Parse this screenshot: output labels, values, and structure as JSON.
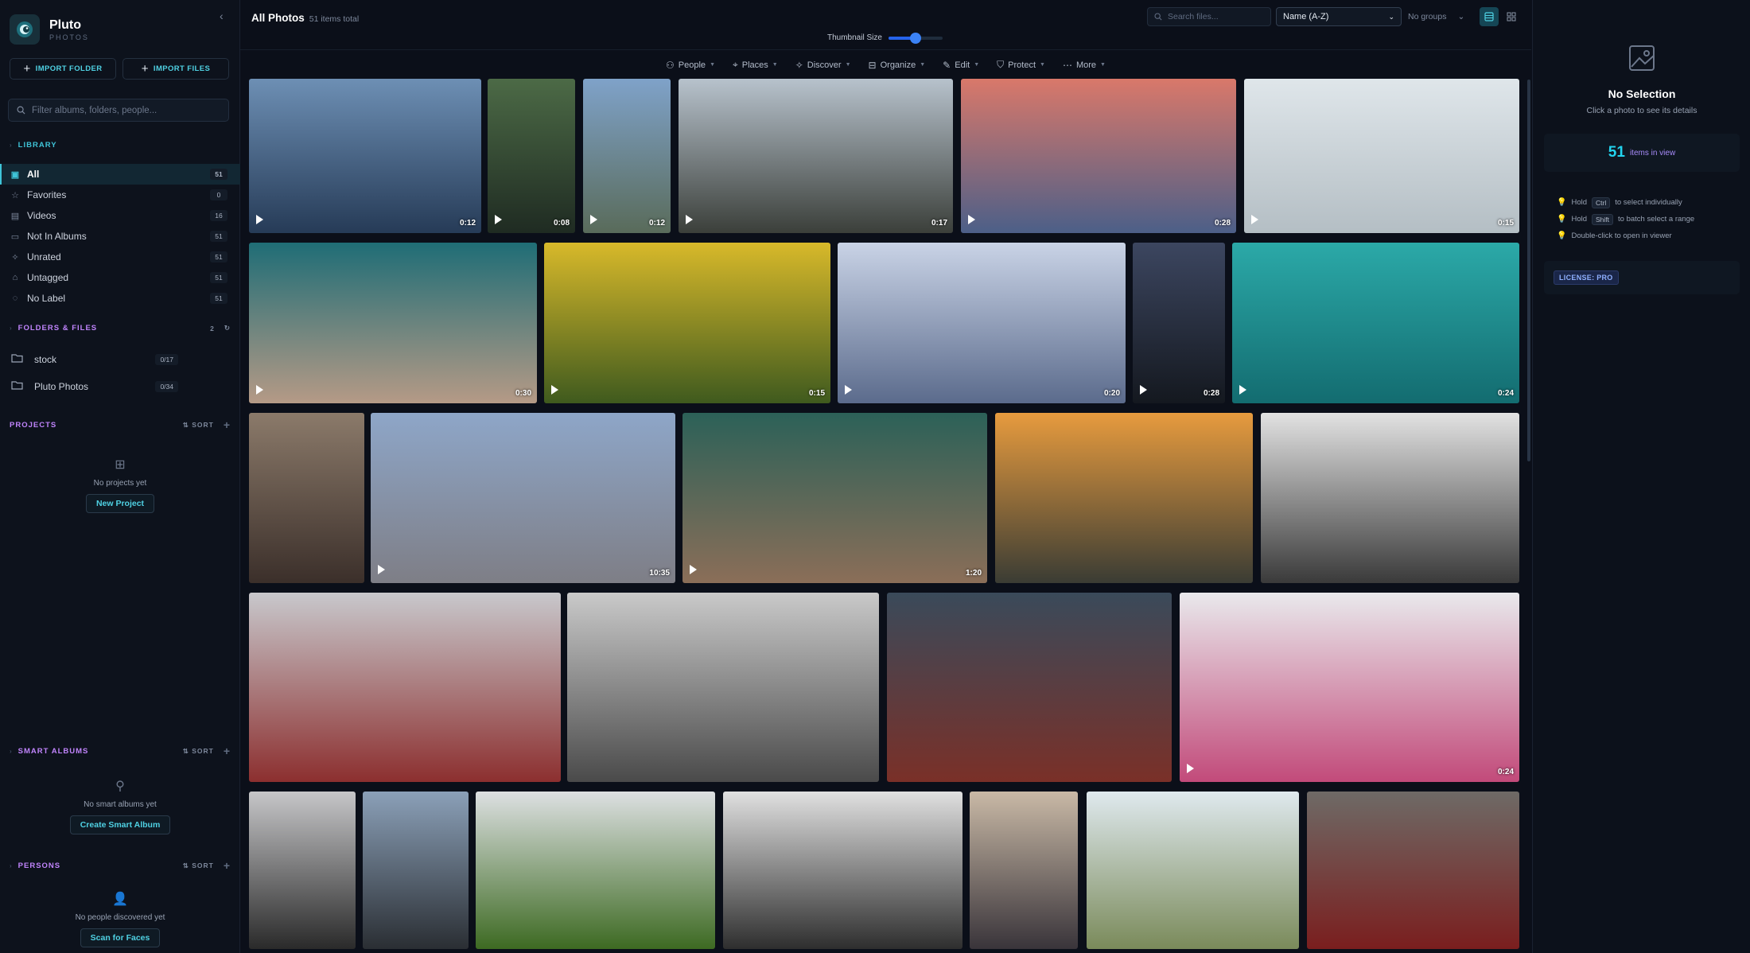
{
  "app": {
    "name": "Pluto",
    "subtitle": "PHOTOS"
  },
  "sidebar": {
    "import_folder": "IMPORT FOLDER",
    "import_files": "IMPORT FILES",
    "filter_placeholder": "Filter albums, folders, people...",
    "library_title": "LIBRARY",
    "library": [
      {
        "label": "All",
        "count": "51",
        "icon": "all-photos-icon"
      },
      {
        "label": "Favorites",
        "count": "0",
        "icon": "star-icon"
      },
      {
        "label": "Videos",
        "count": "16",
        "icon": "film-icon"
      },
      {
        "label": "Not In Albums",
        "count": "51",
        "icon": "folder-off-icon"
      },
      {
        "label": "Unrated",
        "count": "51",
        "icon": "star-outline-icon"
      },
      {
        "label": "Untagged",
        "count": "51",
        "icon": "tag-icon"
      },
      {
        "label": "No Label",
        "count": "51",
        "icon": "label-icon"
      }
    ],
    "folders_title": "FOLDERS & FILES",
    "folders_count": "2",
    "folders": [
      {
        "name": "stock",
        "count": "0/17"
      },
      {
        "name": "Pluto Photos",
        "count": "0/34"
      }
    ],
    "projects_title": "PROJECTS",
    "sort_label": "SORT",
    "projects_empty": "No projects yet",
    "projects_button": "New Project",
    "smart_title": "SMART ALBUMS",
    "smart_empty": "No smart albums yet",
    "smart_button": "Create Smart Album",
    "persons_title": "PERSONS",
    "persons_empty": "No people discovered yet",
    "persons_button": "Scan for Faces"
  },
  "header": {
    "title": "All Photos",
    "count": "51 items total",
    "thumb_label": "Thumbnail Size",
    "thumb_level": 0.5,
    "search_placeholder": "Search files...",
    "sort_value": "Name (A-Z)",
    "group_value": "No groups"
  },
  "toolbar": [
    "People",
    "Places",
    "Discover",
    "Organize",
    "Edit",
    "Protect",
    "More"
  ],
  "photos": [
    {
      "duration": "0:12",
      "video": true,
      "c1": "#6d8fb4",
      "c2": "#263b57"
    },
    {
      "duration": "0:08",
      "video": true,
      "c1": "#4c6a46",
      "c2": "#1f2b22"
    },
    {
      "duration": "0:12",
      "video": true,
      "c1": "#7fa2c9",
      "c2": "#596b5a"
    },
    {
      "duration": "0:17",
      "video": true,
      "c1": "#b7c2cc",
      "c2": "#3b3f3a"
    },
    {
      "duration": "0:28",
      "video": true,
      "c1": "#d9786a",
      "c2": "#4c5f88"
    },
    {
      "duration": "0:15",
      "video": true,
      "c1": "#dfe6ea",
      "c2": "#b4bec4"
    },
    {
      "duration": "0:30",
      "video": true,
      "c1": "#1f6d76",
      "c2": "#b59a86"
    },
    {
      "duration": "0:15",
      "video": true,
      "c1": "#d8b92a",
      "c2": "#3f5a1e"
    },
    {
      "duration": "0:20",
      "video": true,
      "c1": "#c9d3e6",
      "c2": "#5b6b8c"
    },
    {
      "duration": "0:28",
      "video": true,
      "c1": "#3c4660",
      "c2": "#14181f"
    },
    {
      "duration": "0:24",
      "video": true,
      "c1": "#2ba9a8",
      "c2": "#136c70"
    },
    {
      "duration": "",
      "video": false,
      "c1": "#8b7a6a",
      "c2": "#3b2f2a"
    },
    {
      "duration": "10:35",
      "video": true,
      "c1": "#8ea6c8",
      "c2": "#7e7e86"
    },
    {
      "duration": "1:20",
      "video": true,
      "c1": "#2c6158",
      "c2": "#8b6e58"
    },
    {
      "duration": "",
      "video": false,
      "c1": "#e79b3e",
      "c2": "#3a3c34"
    },
    {
      "duration": "",
      "video": false,
      "c1": "#e2e2e2",
      "c2": "#3a3a3a"
    },
    {
      "duration": "",
      "video": false,
      "c1": "#c8c8cc",
      "c2": "#8c2f2f"
    },
    {
      "duration": "",
      "video": false,
      "c1": "#c9c9c9",
      "c2": "#4a4a4a"
    },
    {
      "duration": "",
      "video": false,
      "c1": "#3a4a5a",
      "c2": "#7a3028"
    },
    {
      "duration": "0:24",
      "video": true,
      "c1": "#e9e9ec",
      "c2": "#c24a7a"
    },
    {
      "duration": "",
      "video": false,
      "c1": "#c6c6c8",
      "c2": "#2a2a2a"
    },
    {
      "duration": "",
      "video": false,
      "c1": "#8ba0b8",
      "c2": "#2a2e33"
    },
    {
      "duration": "",
      "video": false,
      "c1": "#dde0e2",
      "c2": "#3d6a22"
    },
    {
      "duration": "",
      "video": false,
      "c1": "#e0e0e0",
      "c2": "#2e2e2e"
    },
    {
      "duration": "",
      "video": false,
      "c1": "#c9b9a6",
      "c2": "#39343a"
    },
    {
      "duration": "",
      "video": false,
      "c1": "#dfe9ee",
      "c2": "#7a8a5a"
    },
    {
      "duration": "",
      "video": false,
      "c1": "#6e6a66",
      "c2": "#7a1e1e"
    }
  ],
  "details": {
    "title": "No Selection",
    "subtitle": "Click a photo to see its details",
    "count": "51",
    "count_label": "items in view",
    "hint1_pre": "Hold",
    "hint1_key": "Ctrl",
    "hint1_post": "to select individually",
    "hint2_pre": "Hold",
    "hint2_key": "Shift",
    "hint2_post": "to batch select a range",
    "hint3": "Double-click to open in viewer",
    "license": "LICENSE: PRO"
  },
  "colors": {
    "accent": "#3fc4d8",
    "purple": "#c084fc",
    "blue": "#3b82f6"
  }
}
